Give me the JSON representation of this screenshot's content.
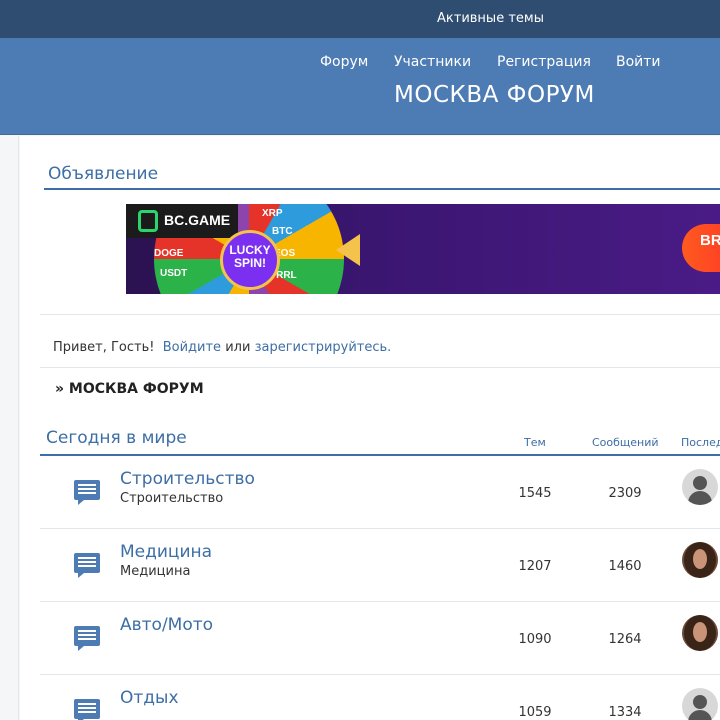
{
  "topbar": {
    "active_topics": "Активные темы"
  },
  "nav": {
    "items": [
      "Форум",
      "Участники",
      "Регистрация",
      "Войти"
    ]
  },
  "brand": {
    "title": "МОСКВА ФОРУМ"
  },
  "announcement": {
    "title": "Объявление",
    "banner": {
      "logo": "BC.GAME",
      "hub": "LUCKY SPIN!",
      "coins": [
        "XRP",
        "BTC",
        "DOGE",
        "EOS",
        "USDT",
        "TRRL"
      ],
      "cta": "BR"
    }
  },
  "greeting": {
    "prefix": "Привет, Гость!",
    "login": "Войдите",
    "or": "или",
    "register": "зарегистрируйтесь",
    "suffix": "."
  },
  "breadcrumb": {
    "text": "» МОСКВА ФОРУМ"
  },
  "section": {
    "title": "Сегодня в мире",
    "col_topics": "Тем",
    "col_posts": "Сообщений",
    "col_last": "Послед"
  },
  "forums": [
    {
      "title": "Строительство",
      "desc": "Строительство",
      "topics": "1545",
      "posts": "2309",
      "avatar": "guest"
    },
    {
      "title": "Медицина",
      "desc": "Медицина",
      "topics": "1207",
      "posts": "1460",
      "avatar": "photo"
    },
    {
      "title": "Авто/Мото",
      "desc": "",
      "topics": "1090",
      "posts": "1264",
      "avatar": "photo"
    },
    {
      "title": "Отдых",
      "desc": "",
      "topics": "1059",
      "posts": "1334",
      "avatar": "guest"
    }
  ],
  "colors": {
    "header": "#4d7bb3",
    "topbar": "#2f4d70",
    "link": "#3d6ea5"
  }
}
